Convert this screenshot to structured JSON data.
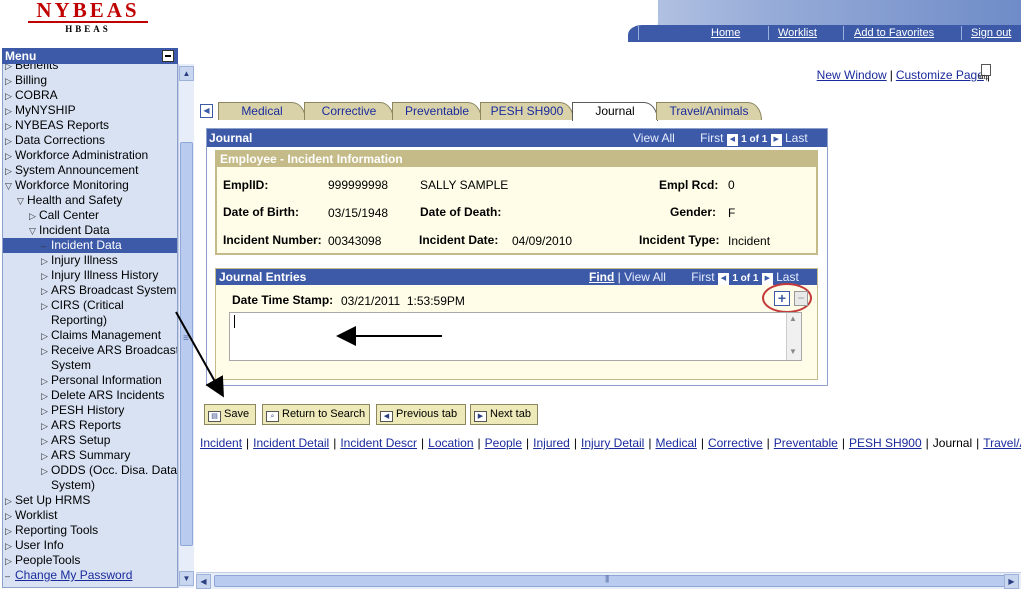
{
  "header": {
    "logo_main": "NYBEAS",
    "logo_sub": "HBEAS",
    "nav": [
      "Home",
      "Worklist",
      "Add to Favorites",
      "Sign out"
    ]
  },
  "menu": {
    "title": "Menu",
    "items": [
      {
        "label": "Benefits",
        "indent": 0,
        "tri": "▷"
      },
      {
        "label": "Billing",
        "indent": 0,
        "tri": "▷"
      },
      {
        "label": "COBRA",
        "indent": 0,
        "tri": "▷"
      },
      {
        "label": "MyNYSHIP",
        "indent": 0,
        "tri": "▷"
      },
      {
        "label": "NYBEAS Reports",
        "indent": 0,
        "tri": "▷"
      },
      {
        "label": "Data Corrections",
        "indent": 0,
        "tri": "▷"
      },
      {
        "label": "Workforce Administration",
        "indent": 0,
        "tri": "▷"
      },
      {
        "label": "System Announcement",
        "indent": 0,
        "tri": "▷"
      },
      {
        "label": "Workforce Monitoring",
        "indent": 0,
        "tri": "▽"
      },
      {
        "label": "Health and Safety",
        "indent": 1,
        "tri": "▽"
      },
      {
        "label": "Call Center",
        "indent": 2,
        "tri": "▷"
      },
      {
        "label": "Incident Data",
        "indent": 2,
        "tri": "▽"
      },
      {
        "label": "Incident Data",
        "indent": 3,
        "tri": "–",
        "selected": true
      },
      {
        "label": "Injury Illness",
        "indent": 3,
        "tri": "▷"
      },
      {
        "label": "Injury Illness History",
        "indent": 3,
        "tri": "▷"
      },
      {
        "label": "ARS Broadcast System",
        "indent": 3,
        "tri": "▷"
      },
      {
        "label": "CIRS (Critical",
        "indent": 3,
        "tri": "▷"
      },
      {
        "label": "Reporting)",
        "indent": 3,
        "tri": ""
      },
      {
        "label": "Claims Management",
        "indent": 3,
        "tri": "▷"
      },
      {
        "label": "Receive ARS Broadcast",
        "indent": 3,
        "tri": "▷"
      },
      {
        "label": "System",
        "indent": 3,
        "tri": ""
      },
      {
        "label": "Personal Information",
        "indent": 3,
        "tri": "▷"
      },
      {
        "label": "Delete ARS Incidents",
        "indent": 3,
        "tri": "▷"
      },
      {
        "label": "PESH History",
        "indent": 3,
        "tri": "▷"
      },
      {
        "label": "ARS Reports",
        "indent": 3,
        "tri": "▷"
      },
      {
        "label": "ARS Setup",
        "indent": 3,
        "tri": "▷"
      },
      {
        "label": "ARS Summary",
        "indent": 3,
        "tri": "▷"
      },
      {
        "label": "ODDS (Occ. Disa. Data",
        "indent": 3,
        "tri": "▷"
      },
      {
        "label": "System)",
        "indent": 3,
        "tri": ""
      },
      {
        "label": "Set Up HRMS",
        "indent": 0,
        "tri": "▷"
      },
      {
        "label": "Worklist",
        "indent": 0,
        "tri": "▷"
      },
      {
        "label": "Reporting Tools",
        "indent": 0,
        "tri": "▷"
      },
      {
        "label": "User Info",
        "indent": 0,
        "tri": "▷"
      },
      {
        "label": "PeopleTools",
        "indent": 0,
        "tri": "▷"
      },
      {
        "label": "Change My Password",
        "indent": 0,
        "tri": "–",
        "link": true
      }
    ]
  },
  "toplinks": {
    "new_window": "New Window",
    "customize_page": "Customize Page",
    "http_label": "http"
  },
  "tabs": [
    "Medical",
    "Corrective",
    "Preventable",
    "PESH SH900",
    "Journal",
    "Travel/Animals"
  ],
  "active_tab": "Journal",
  "journal": {
    "title": "Journal",
    "view_all": "View All",
    "first": "First",
    "count": "1 of 1",
    "last": "Last",
    "employee_section": {
      "title": "Employee - Incident Information",
      "emplid_label": "EmplID:",
      "emplid": "999999998",
      "name": "SALLY SAMPLE",
      "empl_rcd_label": "Empl Rcd:",
      "empl_rcd": "0",
      "dob_label": "Date of Birth:",
      "dob": "03/15/1948",
      "dod_label": "Date of Death:",
      "gender_label": "Gender:",
      "gender": "F",
      "incident_number_label": "Incident Number:",
      "incident_number": "00343098",
      "incident_date_label": "Incident Date:",
      "incident_date": "04/09/2010",
      "incident_type_label": "Incident Type:",
      "incident_type": "Incident"
    },
    "entries": {
      "title": "Journal Entries",
      "find": "Find",
      "view_all": "View All",
      "first": "First",
      "count": "1 of 1",
      "last": "Last",
      "timestamp_label": "Date Time Stamp:",
      "timestamp": "03/21/2011  1:53:59PM",
      "text": ""
    }
  },
  "buttons": {
    "save": "Save",
    "return_to_search": "Return to Search",
    "previous_tab": "Previous tab",
    "next_tab": "Next tab"
  },
  "bottom_links": [
    "Incident",
    "Incident Detail",
    "Incident Descr",
    "Location",
    "People",
    "Injured",
    "Injury Detail",
    "Medical",
    "Corrective",
    "Preventable",
    "PESH SH900",
    "Journal",
    "Travel/Ani"
  ],
  "colors": {
    "brand_red": "#c00000",
    "nav_blue": "#3c5aa8",
    "tab_tan": "#d9d2a8",
    "annotation_red": "#c23a3a"
  }
}
